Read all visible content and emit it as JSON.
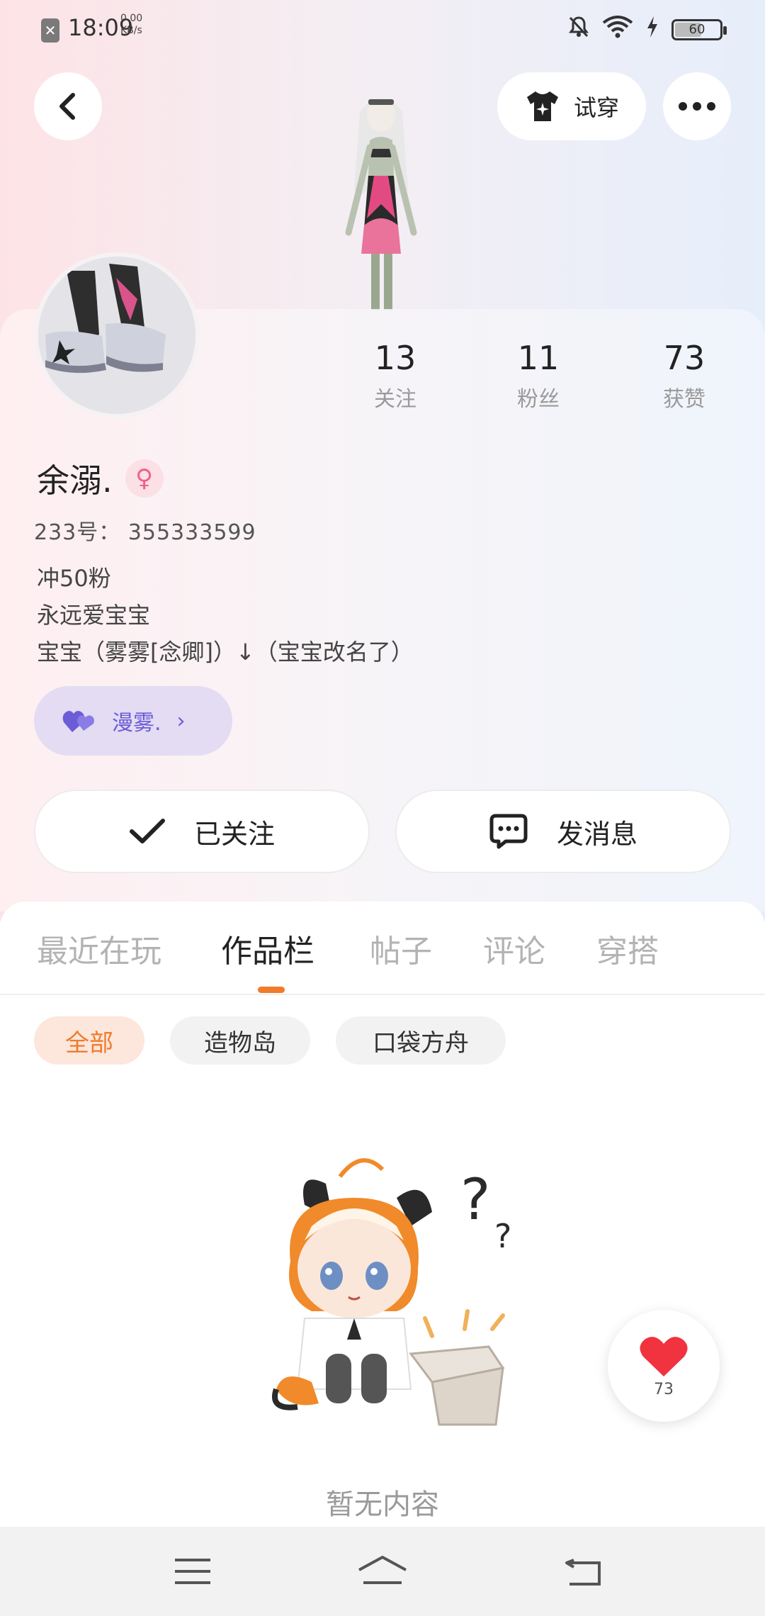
{
  "status_bar": {
    "time": "18:09",
    "speed_value": "0.00",
    "speed_unit": "KB/s",
    "battery": "60"
  },
  "header": {
    "tryon_label": "试穿"
  },
  "profile": {
    "stats": [
      {
        "value": "13",
        "label": "关注"
      },
      {
        "value": "11",
        "label": "粉丝"
      },
      {
        "value": "73",
        "label": "获赞"
      }
    ],
    "nickname": "余溺.",
    "uid": "233号： 355333599",
    "bio_lines": [
      "冲50粉",
      "永远爱宝宝",
      "宝宝（雾雾[念卿]）↓（宝宝改名了）"
    ],
    "tag_label": "漫雾.",
    "follow_label": "已关注",
    "message_label": "发消息"
  },
  "tabs": [
    "最近在玩",
    "作品栏",
    "帖子",
    "评论",
    "穿搭"
  ],
  "active_tab": "作品栏",
  "chips": [
    "全部",
    "造物岛",
    "口袋方舟"
  ],
  "empty_text": "暂无内容",
  "like_fab": {
    "count": "73"
  },
  "colors": {
    "accent": "#f07b2a",
    "tag_purple": "#6c5cd6",
    "heart_red": "#f0333f"
  }
}
